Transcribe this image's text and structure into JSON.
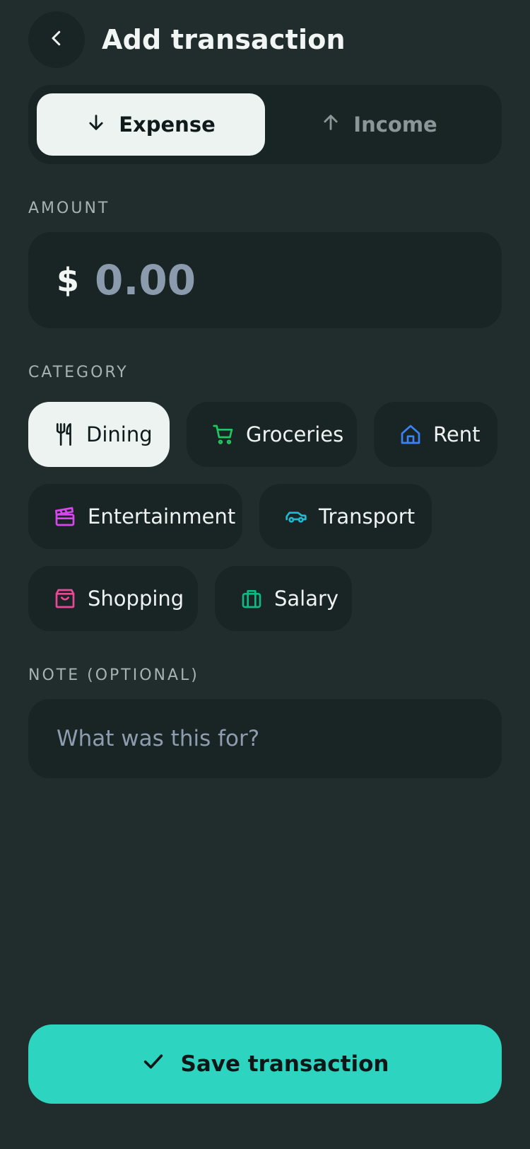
{
  "header": {
    "title": "Add transaction",
    "back_icon": "chevron-left-icon"
  },
  "type_toggle": {
    "options": [
      {
        "label": "Expense",
        "icon": "arrow-down-icon",
        "active": true
      },
      {
        "label": "Income",
        "icon": "arrow-up-icon",
        "active": false
      }
    ]
  },
  "amount": {
    "label": "AMOUNT",
    "currency": "$",
    "placeholder": "0.00",
    "value": ""
  },
  "category": {
    "label": "CATEGORY",
    "items": [
      {
        "label": "Dining",
        "icon": "fork-knife-icon",
        "color": "#111a1a",
        "active": true
      },
      {
        "label": "Groceries",
        "icon": "cart-icon",
        "color": "#22c55e",
        "active": false
      },
      {
        "label": "Rent",
        "icon": "home-icon",
        "color": "#3b82f6",
        "active": false
      },
      {
        "label": "Entertainment",
        "icon": "clapperboard-icon",
        "color": "#d946ef",
        "active": false
      },
      {
        "label": "Transport",
        "icon": "car-icon",
        "color": "#22b8cf",
        "active": false
      },
      {
        "label": "Shopping",
        "icon": "shopping-bag-icon",
        "color": "#ec4899",
        "active": false
      },
      {
        "label": "Salary",
        "icon": "briefcase-icon",
        "color": "#10b981",
        "active": false
      }
    ]
  },
  "note": {
    "label": "NOTE (OPTIONAL)",
    "placeholder": "What was this for?",
    "value": ""
  },
  "save": {
    "label": "Save transaction",
    "icon": "check-icon"
  },
  "colors": {
    "background": "#212d2d",
    "surface": "#192424",
    "active_chip": "#ecf3f0",
    "accent": "#2dd4bf"
  }
}
